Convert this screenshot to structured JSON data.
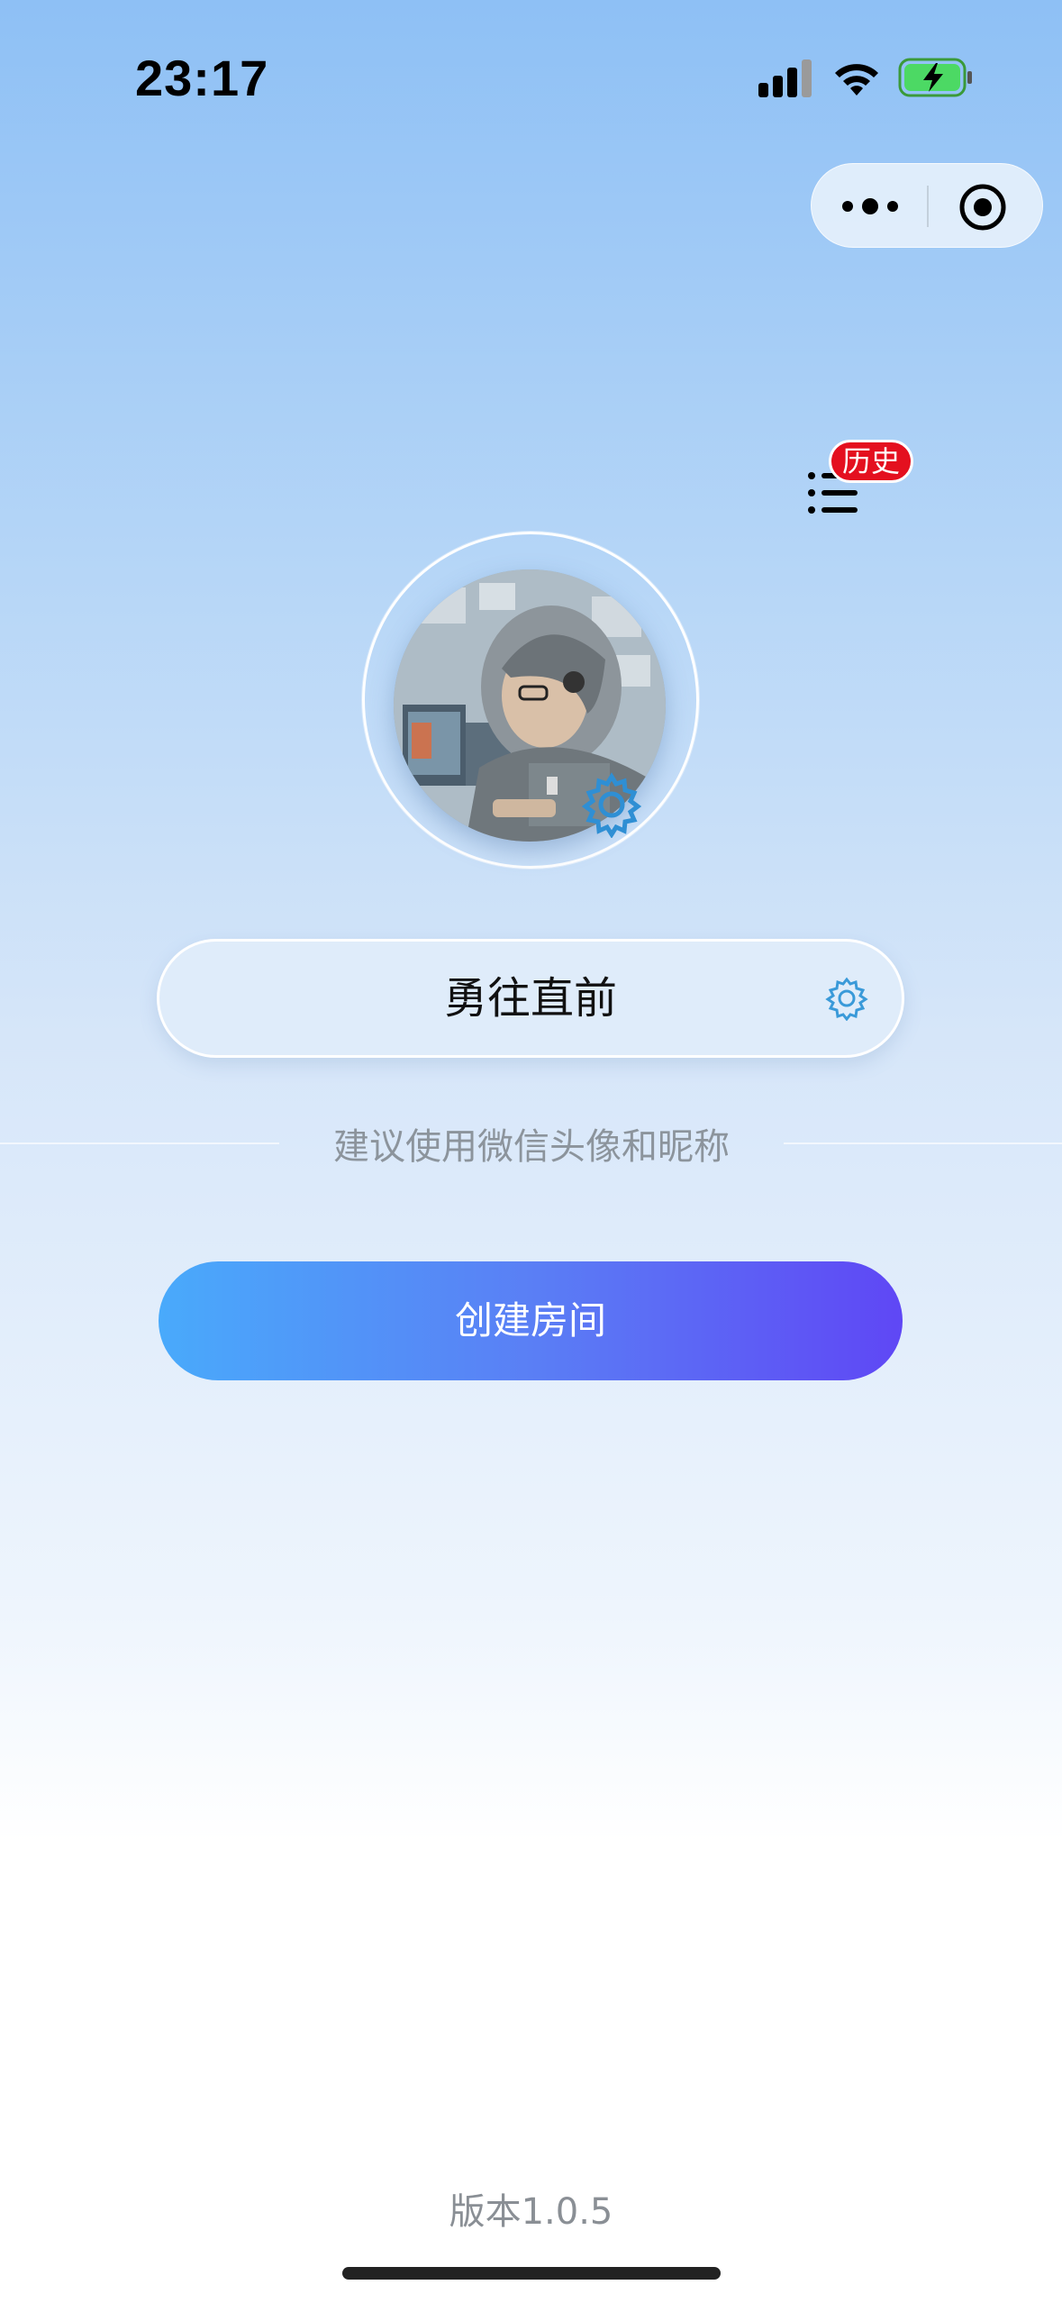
{
  "status_bar": {
    "time": "23:17"
  },
  "history": {
    "badge_label": "历史"
  },
  "profile": {
    "nickname": "勇往直前",
    "hint": "建议使用微信头像和昵称"
  },
  "actions": {
    "create_room_label": "创建房间"
  },
  "footer": {
    "version": "版本1.0.5"
  },
  "colors": {
    "accent_start": "#49aafb",
    "accent_end": "#5f47f5",
    "badge": "#e4101f",
    "gear": "#3a9ad9",
    "battery_fill": "#4cd964"
  },
  "icons": [
    "signal-icon",
    "wifi-icon",
    "battery-icon",
    "more-icon",
    "close-icon",
    "list-icon",
    "gear-icon"
  ]
}
